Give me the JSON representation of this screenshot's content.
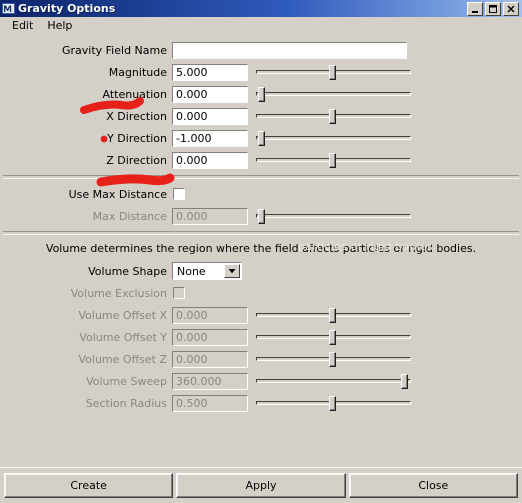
{
  "window": {
    "title": "Gravity Options",
    "icon": "maya-m-icon",
    "controls": {
      "minimize": "minimize-icon",
      "maximize": "maximize-icon",
      "close": "close-icon"
    }
  },
  "menubar": {
    "items": [
      {
        "label": "Edit"
      },
      {
        "label": "Help"
      }
    ]
  },
  "form": {
    "gravity_field_name": {
      "label": "Gravity Field Name",
      "value": ""
    },
    "rows": [
      {
        "label": "Magnitude",
        "value": "5.000",
        "slider": 50,
        "disabled": false
      },
      {
        "label": "Attenuation",
        "value": "0.000",
        "slider": 2,
        "disabled": false
      },
      {
        "label": "X Direction",
        "value": "0.000",
        "slider": 50,
        "disabled": false
      },
      {
        "label": "Y Direction",
        "value": "-1.000",
        "slider": 2,
        "disabled": false
      },
      {
        "label": "Z Direction",
        "value": "0.000",
        "slider": 50,
        "disabled": false
      }
    ],
    "use_max_distance": {
      "label": "Use Max Distance",
      "checked": false
    },
    "max_distance": {
      "label": "Max Distance",
      "value": "0.000",
      "slider": 2,
      "disabled": true
    }
  },
  "volume": {
    "note": "Volume determines the region where the field affects particles or rigid bodies.",
    "watermark": "particles or rigid bodies.",
    "shape": {
      "label": "Volume Shape",
      "value": "None",
      "arrow": "chevron-down-icon"
    },
    "exclusion": {
      "label": "Volume Exclusion",
      "checked": false,
      "disabled": true
    },
    "rows": [
      {
        "label": "Volume Offset X",
        "value": "0.000",
        "slider": 50,
        "disabled": true
      },
      {
        "label": "Volume Offset Y",
        "value": "0.000",
        "slider": 50,
        "disabled": true
      },
      {
        "label": "Volume Offset Z",
        "value": "0.000",
        "slider": 50,
        "disabled": true
      },
      {
        "label": "Volume Sweep",
        "value": "360.000",
        "slider": 97,
        "disabled": true
      },
      {
        "label": "Section Radius",
        "value": "0.500",
        "slider": 50,
        "disabled": true
      }
    ]
  },
  "buttons": [
    {
      "label": "Create"
    },
    {
      "label": "Apply"
    },
    {
      "label": "Close"
    }
  ],
  "annotations": {
    "color": "#e8201a",
    "marks": [
      {
        "name": "magnitude-underline"
      },
      {
        "name": "attenuation-dot"
      },
      {
        "name": "y-direction-underline"
      }
    ]
  }
}
